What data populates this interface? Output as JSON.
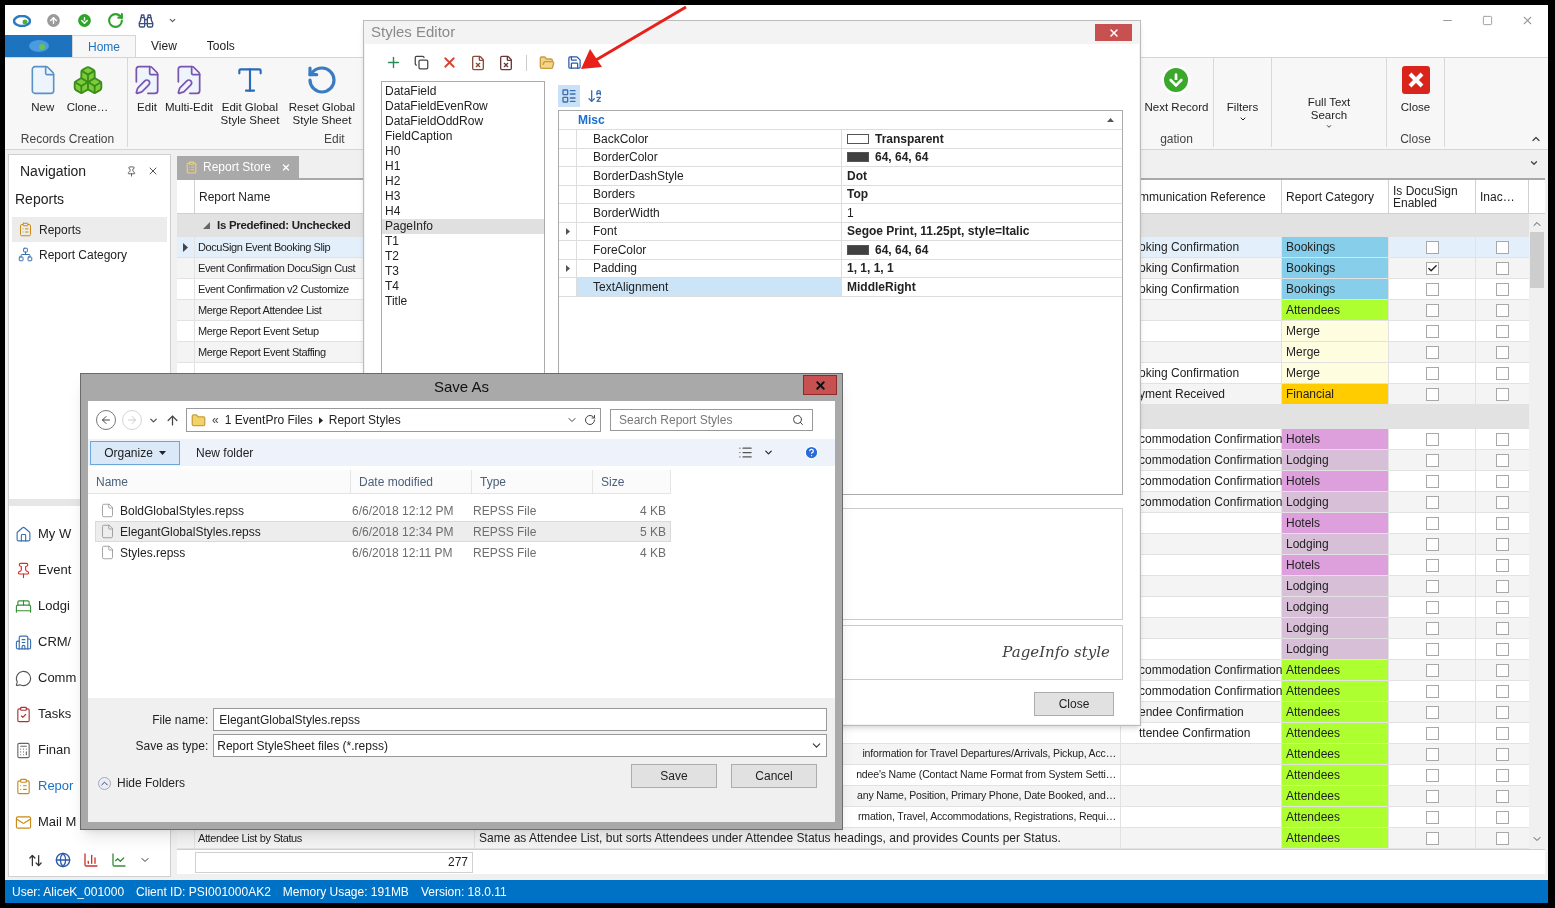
{
  "ribbon": {
    "tabs": [
      {
        "label": "Home",
        "selected": true
      },
      {
        "label": "View",
        "selected": false
      },
      {
        "label": "Tools",
        "selected": false
      }
    ],
    "left_groups": [
      {
        "label": "Records Creation",
        "buttons": [
          {
            "label": "New",
            "dropdown": false
          },
          {
            "label": "Clone…",
            "dropdown": false
          }
        ]
      },
      {
        "label": "Edit",
        "buttons": [
          {
            "label": "Edit",
            "dropdown": false
          },
          {
            "label": "Multi-Edit",
            "dropdown": false
          },
          {
            "label": "Edit Global Style Sheet",
            "dropdown": false
          },
          {
            "label": "Reset Global Style Sheet",
            "dropdown": false
          }
        ]
      }
    ],
    "right_groups": [
      {
        "label": "gation",
        "buttons": [
          {
            "label": "Next Record",
            "dropdown": false
          }
        ]
      },
      {
        "buttons": [
          {
            "label": "Filters",
            "dropdown": true
          }
        ]
      },
      {
        "buttons": [
          {
            "label": "Full Text Search",
            "dropdown": true
          }
        ]
      },
      {
        "label": "Close",
        "buttons": [
          {
            "label": "Close",
            "dropdown": false
          }
        ]
      }
    ]
  },
  "navigation": {
    "title": "Navigation",
    "section": "Reports",
    "items": [
      {
        "label": "Reports",
        "selected": true
      },
      {
        "label": "Report Category",
        "selected": false
      }
    ],
    "modules": [
      {
        "label": "My W",
        "selected": false
      },
      {
        "label": "Event",
        "selected": false
      },
      {
        "label": "Lodgi",
        "selected": false
      },
      {
        "label": "CRM/",
        "selected": false
      },
      {
        "label": "Comm",
        "selected": false
      },
      {
        "label": "Tasks",
        "selected": false
      },
      {
        "label": "Finan",
        "selected": false
      },
      {
        "label": "Repor",
        "selected": true
      },
      {
        "label": "Mail M",
        "selected": false
      }
    ]
  },
  "document_tab": {
    "label": "Report Store"
  },
  "grid": {
    "columns": {
      "name": "Report Name",
      "comm_ref": "mmunication Reference",
      "category": "Report Category",
      "docusign": "Is DocuSign Enabled",
      "inactive": "Inac…"
    },
    "groups": [
      {
        "label": "Is Predefined: Unchecked",
        "expanded": true,
        "rows": [
          {
            "name": "DocuSign Event Booking Slip",
            "comm_ref": "oking Confirmation",
            "category": "Bookings",
            "color": "#87ceeb",
            "docusign": false,
            "inactive": false,
            "selected": true
          },
          {
            "name": "Event Confirmation DocuSign Cust",
            "comm_ref": "oking Confirmation",
            "category": "Bookings",
            "color": "#87ceeb",
            "docusign": true,
            "inactive": false,
            "selected": false
          },
          {
            "name": "Event Confirmation v2 Customize",
            "comm_ref": "oking Confirmation",
            "category": "Bookings",
            "color": "#87ceeb",
            "docusign": false,
            "inactive": false,
            "selected": false
          },
          {
            "name": "Merge Report Attendee List",
            "category": "Attendees",
            "color": "#adff2f",
            "docusign": false,
            "inactive": false,
            "selected": false
          },
          {
            "name": "Merge Report Event Setup",
            "category": "Merge",
            "color": "#fffde0",
            "docusign": false,
            "inactive": false,
            "selected": false
          },
          {
            "name": "Merge Report Event Staffing",
            "category": "Merge",
            "color": "#fffde0",
            "docusign": false,
            "inactive": false,
            "selected": false
          },
          {
            "comm_ref": "oking Confirmation",
            "category": "Merge",
            "color": "#fffde0",
            "docusign": false,
            "inactive": false,
            "selected": false
          },
          {
            "comm_ref": "yment Received",
            "category": "Financial",
            "color": "#ffcc00",
            "docusign": false,
            "inactive": false,
            "selected": false
          }
        ]
      },
      {
        "rows": [
          {
            "comm_ref": "commodation Confirmation",
            "category": "Hotels",
            "color": "#dda0dd",
            "docusign": false,
            "inactive": false,
            "selected": false
          },
          {
            "comm_ref": "commodation Confirmation",
            "category": "Lodging",
            "color": "#d8bfd8",
            "docusign": false,
            "inactive": false,
            "selected": false
          },
          {
            "comm_ref": "commodation Confirmation",
            "category": "Hotels",
            "color": "#dda0dd",
            "docusign": false,
            "inactive": false,
            "selected": false
          },
          {
            "comm_ref": "commodation Confirmation",
            "category": "Lodging",
            "color": "#d8bfd8",
            "docusign": false,
            "inactive": false,
            "selected": false
          },
          {
            "category": "Hotels",
            "color": "#dda0dd",
            "docusign": false,
            "inactive": false,
            "selected": false
          },
          {
            "category": "Lodging",
            "color": "#d8bfd8",
            "docusign": false,
            "inactive": false,
            "selected": false
          },
          {
            "category": "Hotels",
            "color": "#dda0dd",
            "docusign": false,
            "inactive": false,
            "selected": false
          },
          {
            "category": "Lodging",
            "color": "#d8bfd8",
            "docusign": false,
            "inactive": false,
            "selected": false
          },
          {
            "category": "Lodging",
            "color": "#d8bfd8",
            "docusign": false,
            "inactive": false,
            "selected": false
          },
          {
            "category": "Lodging",
            "color": "#d8bfd8",
            "docusign": false,
            "inactive": false,
            "selected": false
          },
          {
            "category": "Lodging",
            "color": "#d8bfd8",
            "docusign": false,
            "inactive": false,
            "selected": false
          },
          {
            "comm_ref": "commodation Confirmation",
            "category": "Attendees",
            "color": "#adff2f",
            "docusign": false,
            "inactive": false,
            "selected": false
          },
          {
            "comm_ref": "commodation Confirmation",
            "category": "Attendees",
            "color": "#adff2f",
            "docusign": false,
            "inactive": false,
            "selected": false
          },
          {
            "comm_ref": "endee Confirmation",
            "category": "Attendees",
            "color": "#adff2f",
            "docusign": false,
            "inactive": false,
            "selected": false
          },
          {
            "comm_ref": "ttendee Confirmation",
            "category": "Attendees",
            "color": "#adff2f",
            "docusign": false,
            "inactive": false,
            "selected": false
          },
          {
            "description_tail": "information for Travel Departures/Arrivals, Pickup, Acc…",
            "category": "Attendees",
            "color": "#adff2f",
            "docusign": false,
            "inactive": false,
            "selected": false
          },
          {
            "description_tail": "ndee's Name (Contact Name Format from System Setti…",
            "category": "Attendees",
            "color": "#adff2f",
            "docusign": false,
            "inactive": false,
            "selected": false
          },
          {
            "description_tail": "any Name, Position, Primary Phone, Date Booked, and…",
            "category": "Attendees",
            "color": "#adff2f",
            "docusign": false,
            "inactive": false,
            "selected": false
          },
          {
            "description_tail": "rmation, Travel, Accommodations, Registrations, Requi…",
            "category": "Attendees",
            "color": "#adff2f",
            "docusign": false,
            "inactive": false,
            "selected": false
          },
          {
            "name": "Attendee List by Status",
            "description": "Same as Attendee List, but sorts Attendees under Attendee Status headings, and provides Counts per Status.",
            "category": "Attendees",
            "color": "#adff2f",
            "docusign": false,
            "inactive": false,
            "selected": false
          }
        ]
      }
    ],
    "footer_count": "277"
  },
  "status_bar": [
    "User: AliceK_001000",
    "Client ID: PSI001000AK2",
    "Memory Usage: 191MB",
    "Version: 18.0.11"
  ],
  "styles_editor": {
    "title": "Styles Editor",
    "styles": [
      {
        "label": "DataField",
        "selected": false
      },
      {
        "label": "DataFieldEvenRow",
        "selected": false
      },
      {
        "label": "DataFieldOddRow",
        "selected": false
      },
      {
        "label": "FieldCaption",
        "selected": false
      },
      {
        "label": "H0",
        "selected": false
      },
      {
        "label": "H1",
        "selected": false
      },
      {
        "label": "H2",
        "selected": false
      },
      {
        "label": "H3",
        "selected": false
      },
      {
        "label": "H4",
        "selected": false
      },
      {
        "label": "PageInfo",
        "selected": true
      },
      {
        "label": "T1",
        "selected": false
      },
      {
        "label": "T2",
        "selected": false
      },
      {
        "label": "T3",
        "selected": false
      },
      {
        "label": "T4",
        "selected": false
      },
      {
        "label": "Title",
        "selected": false
      }
    ],
    "view_modes": [
      {
        "kind": "categorized",
        "selected": true
      },
      {
        "kind": "alphabetical",
        "selected": false
      }
    ],
    "category": "Misc",
    "category_expanded": true,
    "properties": [
      {
        "name": "BackColor",
        "value": "Transparent",
        "kind": "color",
        "color": "#ffffff",
        "modified": true,
        "selected": false
      },
      {
        "name": "BorderColor",
        "value": "64, 64, 64",
        "kind": "color",
        "color": "#404040",
        "modified": true,
        "selected": false
      },
      {
        "name": "BorderDashStyle",
        "value": "Dot",
        "kind": "plain",
        "modified": true,
        "selected": false
      },
      {
        "name": "Borders",
        "value": "Top",
        "kind": "plain",
        "modified": true,
        "selected": false
      },
      {
        "name": "BorderWidth",
        "value": "1",
        "kind": "plain",
        "modified": false,
        "selected": false
      },
      {
        "name": "Font",
        "value": "Segoe Print, 11.25pt, style=Italic",
        "kind": "expandable",
        "expanded": false,
        "modified": true,
        "selected": false
      },
      {
        "name": "ForeColor",
        "value": "64, 64, 64",
        "kind": "color",
        "color": "#404040",
        "modified": true,
        "selected": false
      },
      {
        "name": "Padding",
        "value": "1, 1, 1, 1",
        "kind": "expandable",
        "expanded": false,
        "modified": true,
        "selected": false
      },
      {
        "name": "TextAlignment",
        "value": "MiddleRight",
        "kind": "plain",
        "modified": true,
        "selected": true
      }
    ],
    "preview": "PageInfo style",
    "close": "Close"
  },
  "save_as": {
    "title": "Save As",
    "overflow": "«",
    "path": [
      "1 EventPro Files",
      "Report Styles"
    ],
    "forward_enabled": false,
    "search_placeholder": "Search Report Styles",
    "organize": "Organize",
    "new_folder": "New folder",
    "columns": [
      "Name",
      "Date modified",
      "Type",
      "Size"
    ],
    "files": [
      {
        "name": "BoldGlobalStyles.repss",
        "date": "6/6/2018 12:12 PM",
        "type": "REPSS File",
        "size": "4 KB",
        "selected": false
      },
      {
        "name": "ElegantGlobalStyles.repss",
        "date": "6/6/2018 12:34 PM",
        "type": "REPSS File",
        "size": "5 KB",
        "selected": true
      },
      {
        "name": "Styles.repss",
        "date": "6/6/2018 12:11 PM",
        "type": "REPSS File",
        "size": "4 KB",
        "selected": false
      }
    ],
    "file_name_label": "File name:",
    "file_name": "ElegantGlobalStyles.repss",
    "type_label": "Save as type:",
    "type_value": "Report StyleSheet files (*.repss)",
    "hide_folders": "Hide Folders",
    "save": "Save",
    "cancel": "Cancel"
  }
}
